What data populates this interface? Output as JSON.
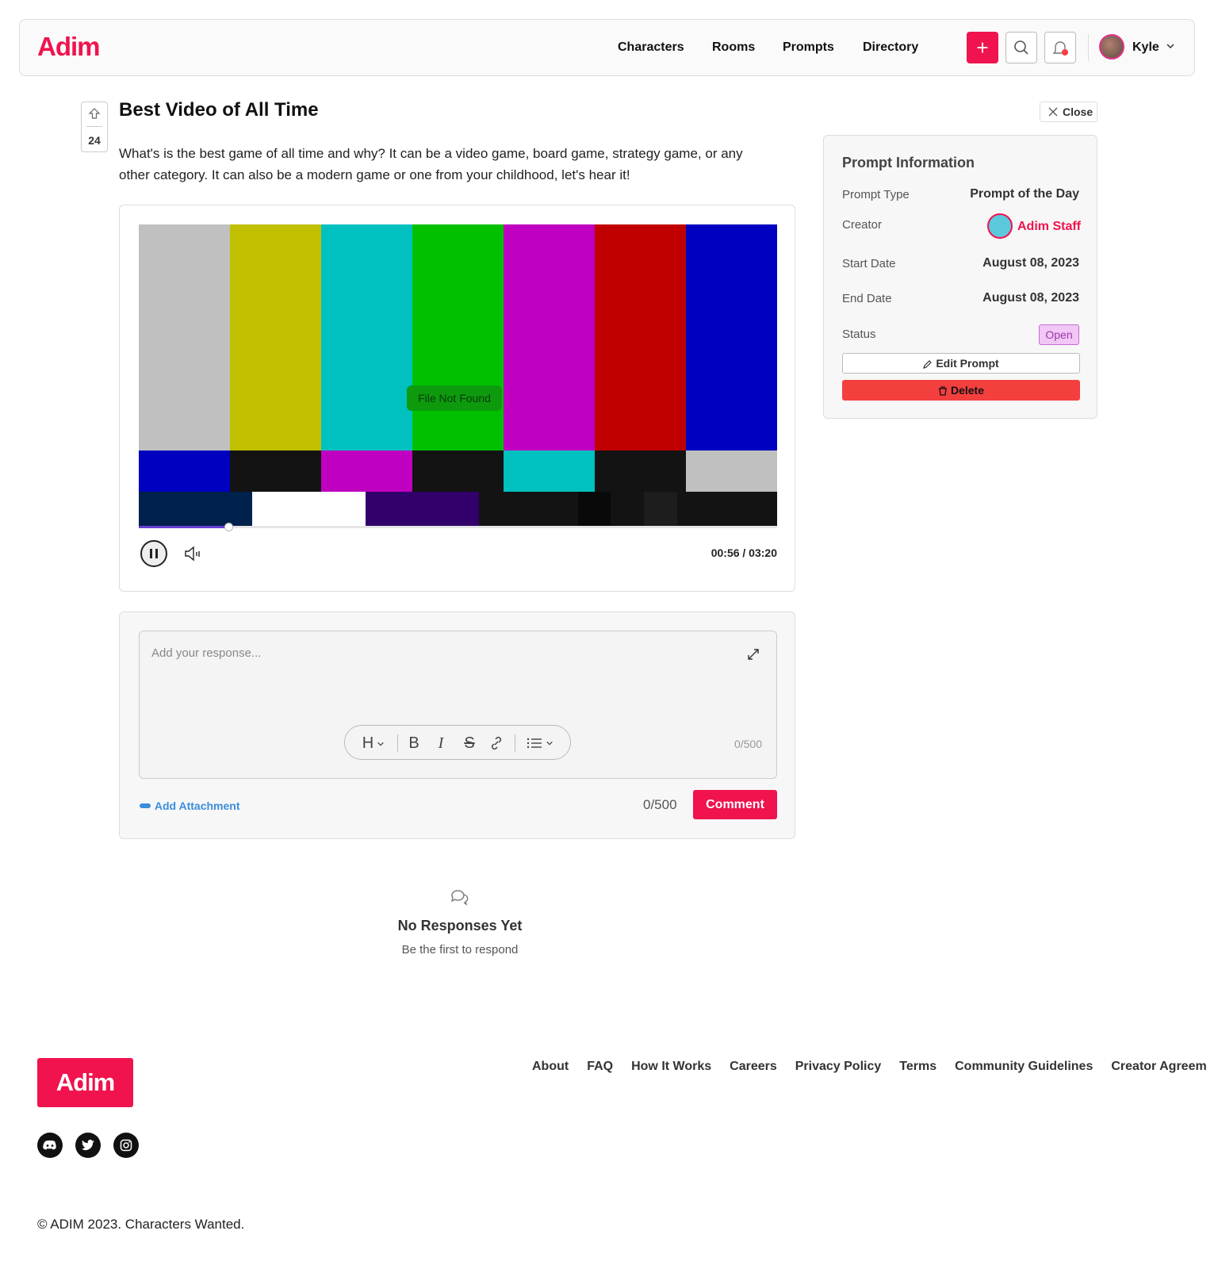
{
  "header": {
    "logo": "Adim",
    "nav": [
      "Characters",
      "Rooms",
      "Prompts",
      "Directory"
    ],
    "user_name": "Kyle",
    "plus_icon": "plus-icon",
    "search_icon": "search-icon",
    "bell_icon": "bell-icon"
  },
  "prompt": {
    "votes": "24",
    "title": "Best Video of All Time",
    "description": "What's is the best game of all time and why? It can be a video game, board game, strategy game, or any other category. It can also be a modern game or one from your childhood, let's hear it!"
  },
  "video": {
    "overlay_text": "File Not Found",
    "time": "00:56 / 03:20",
    "progress_fraction": 0.14,
    "bar_colors_top": [
      "#c0c0c0",
      "#c0c000",
      "#00c0c0",
      "#00c000",
      "#c000c0",
      "#c00000",
      "#0000c0"
    ],
    "bar_colors_mid": [
      "#0000c0",
      "#131313",
      "#c000c0",
      "#131313",
      "#00c0c0",
      "#131313",
      "#c0c0c0"
    ],
    "bar_colors_bottom": [
      "#00214c",
      "#ffffff",
      "#32006a",
      "#131313",
      "#090909",
      "#131313",
      "#1d1d1d",
      "#131313"
    ]
  },
  "comment": {
    "placeholder": "Add your response...",
    "inner_count": "0/500",
    "attach_label": "Add Attachment",
    "count": "0/500",
    "submit_label": "Comment"
  },
  "empty_state": {
    "title": "No Responses Yet",
    "subtitle": "Be the first to respond"
  },
  "sidebar": {
    "close_label": "Close",
    "title": "Prompt Information",
    "prompt_type_label": "Prompt Type",
    "prompt_type_value": "Prompt of the Day",
    "creator_label": "Creator",
    "creator_value": "Adim Staff",
    "start_label": "Start Date",
    "start_value": "August 08, 2023",
    "end_label": "End Date",
    "end_value": "August 08, 2023",
    "status_label": "Status",
    "status_value": "Open",
    "edit_label": "Edit Prompt",
    "delete_label": "Delete"
  },
  "footer": {
    "logo": "Adim",
    "links": [
      "About",
      "FAQ",
      "How It Works",
      "Careers",
      "Privacy Policy",
      "Terms",
      "Community Guidelines",
      "Creator Agreem"
    ],
    "social_icons": [
      "discord-icon",
      "twitter-icon",
      "instagram-icon"
    ],
    "copyright": "© ADIM 2023. Characters Wanted."
  },
  "colors": {
    "brand": "#f0134d",
    "delete": "#f43f3f",
    "link": "#3b8ddd"
  }
}
